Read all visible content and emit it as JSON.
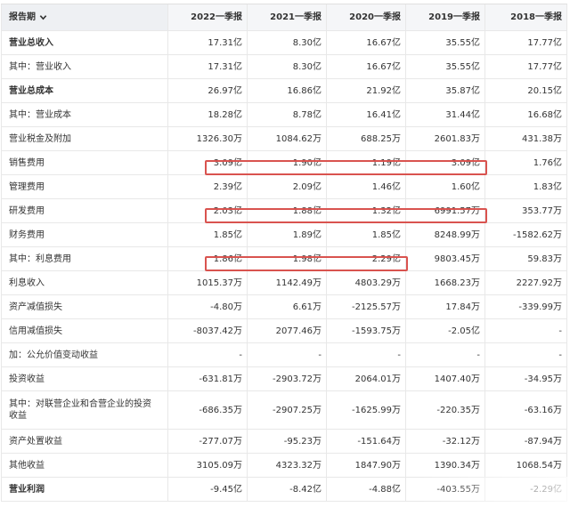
{
  "header": {
    "label": "报告期",
    "periods": [
      "2022一季报",
      "2021一季报",
      "2020一季报",
      "2019一季报",
      "2018一季报"
    ]
  },
  "rows": [
    {
      "label": "营业总收入",
      "bold": true,
      "values": [
        "17.31亿",
        "8.30亿",
        "16.67亿",
        "35.55亿",
        "17.77亿"
      ]
    },
    {
      "label": "其中：营业收入",
      "bold": false,
      "values": [
        "17.31亿",
        "8.30亿",
        "16.67亿",
        "35.55亿",
        "17.77亿"
      ]
    },
    {
      "label": "营业总成本",
      "bold": true,
      "values": [
        "26.97亿",
        "16.86亿",
        "21.92亿",
        "35.87亿",
        "20.15亿"
      ]
    },
    {
      "label": "其中：营业成本",
      "bold": false,
      "values": [
        "18.28亿",
        "8.78亿",
        "16.41亿",
        "31.44亿",
        "16.68亿"
      ]
    },
    {
      "label": "营业税金及附加",
      "bold": false,
      "values": [
        "1326.30万",
        "1084.62万",
        "688.25万",
        "2601.83万",
        "431.38万"
      ]
    },
    {
      "label": "销售费用",
      "bold": false,
      "values": [
        "3.09亿",
        "1.90亿",
        "1.19亿",
        "3.09亿",
        "1.76亿"
      ]
    },
    {
      "label": "管理费用",
      "bold": false,
      "values": [
        "2.39亿",
        "2.09亿",
        "1.46亿",
        "1.60亿",
        "1.83亿"
      ]
    },
    {
      "label": "研发费用",
      "bold": false,
      "values": [
        "2.03亿",
        "1.88亿",
        "1.32亿",
        "6991.57万",
        "353.77万"
      ]
    },
    {
      "label": "财务费用",
      "bold": false,
      "values": [
        "1.85亿",
        "1.89亿",
        "1.85亿",
        "8248.99万",
        "-1582.62万"
      ]
    },
    {
      "label": "其中：利息费用",
      "bold": false,
      "values": [
        "1.86亿",
        "1.98亿",
        "2.29亿",
        "9803.45万",
        "59.83万"
      ]
    },
    {
      "label": "利息收入",
      "bold": false,
      "values": [
        "1015.37万",
        "1142.49万",
        "4803.29万",
        "1668.23万",
        "2227.92万"
      ]
    },
    {
      "label": "资产减值损失",
      "bold": false,
      "values": [
        "-4.80万",
        "6.61万",
        "-2125.57万",
        "17.84万",
        "-339.99万"
      ]
    },
    {
      "label": "信用减值损失",
      "bold": false,
      "values": [
        "-8037.42万",
        "2077.46万",
        "-1593.75万",
        "-2.05亿",
        "-"
      ]
    },
    {
      "label": "加：公允价值变动收益",
      "bold": false,
      "values": [
        "-",
        "-",
        "-",
        "-",
        "-"
      ]
    },
    {
      "label": "投资收益",
      "bold": false,
      "values": [
        "-631.81万",
        "-2903.72万",
        "2064.01万",
        "1407.40万",
        "-34.95万"
      ]
    },
    {
      "label": "其中：对联营企业和合营企业的投资收益",
      "bold": false,
      "tall": true,
      "values": [
        "-686.35万",
        "-2907.25万",
        "-1625.99万",
        "-220.35万",
        "-63.16万"
      ]
    },
    {
      "label": "资产处置收益",
      "bold": false,
      "values": [
        "-277.07万",
        "-95.23万",
        "-151.64万",
        "-32.12万",
        "-87.94万"
      ]
    },
    {
      "label": "其他收益",
      "bold": false,
      "values": [
        "3105.09万",
        "4323.32万",
        "1847.90万",
        "1390.34万",
        "1068.54万"
      ]
    },
    {
      "label": "营业利润",
      "bold": true,
      "values": [
        "-9.45亿",
        "-8.42亿",
        "-4.88亿",
        "-403.55万",
        "-2.29亿"
      ]
    }
  ],
  "highlight_color": "#d9534f"
}
